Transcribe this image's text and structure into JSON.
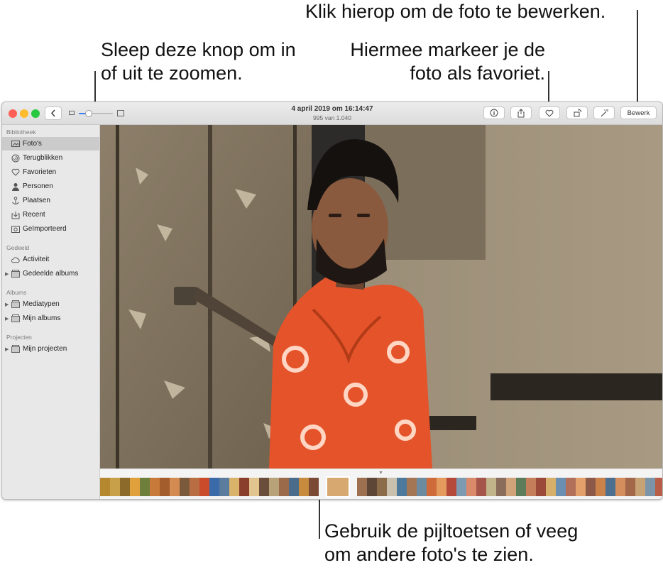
{
  "callouts": {
    "zoom": [
      "Sleep deze knop om in",
      "of uit te zoomen."
    ],
    "favorite": [
      "Hiermee markeer je de",
      "foto als favoriet."
    ],
    "edit": "Klik hierop om de foto te bewerken.",
    "arrows": [
      "Gebruik de pijltoetsen of veeg",
      "om andere foto's te zien."
    ]
  },
  "window": {
    "title": "4 april 2019 om 16:14:47",
    "subtitle": "995 van 1.040"
  },
  "toolbar": {
    "back_icon": "chevron-left-icon",
    "zoom_level": 0.3,
    "info_icon": "info-icon",
    "share_icon": "share-icon",
    "favorite_icon": "heart-icon",
    "rotate_icon": "rotate-icon",
    "enhance_icon": "magic-wand-icon",
    "edit_label": "Bewerk"
  },
  "sidebar": {
    "sections": [
      {
        "title": "Bibliotheek",
        "items": [
          {
            "label": "Foto's",
            "icon": "photos-icon",
            "selected": true
          },
          {
            "label": "Terugblikken",
            "icon": "memories-icon"
          },
          {
            "label": "Favorieten",
            "icon": "heart-icon"
          },
          {
            "label": "Personen",
            "icon": "person-icon"
          },
          {
            "label": "Plaatsen",
            "icon": "pin-icon"
          },
          {
            "label": "Recent",
            "icon": "import-icon"
          },
          {
            "label": "Geïmporteerd",
            "icon": "camera-icon"
          }
        ]
      },
      {
        "title": "Gedeeld",
        "items": [
          {
            "label": "Activiteit",
            "icon": "cloud-icon"
          },
          {
            "label": "Gedeelde albums",
            "icon": "folder-icon",
            "expandable": true
          }
        ]
      },
      {
        "title": "Albums",
        "items": [
          {
            "label": "Mediatypen",
            "icon": "folder-icon",
            "expandable": true
          },
          {
            "label": "Mijn albums",
            "icon": "folder-icon",
            "expandable": true
          }
        ]
      },
      {
        "title": "Projecten",
        "items": [
          {
            "label": "Mijn projecten",
            "icon": "folder-icon",
            "expandable": true
          }
        ]
      }
    ]
  },
  "colors": {
    "close": "#fe5f57",
    "minimize": "#febc2e",
    "zoom": "#28c840",
    "accent": "#3b82f6"
  },
  "filmstrip": {
    "thumbnail_colors": [
      "#b5872f",
      "#c9a04a",
      "#8c6b2a",
      "#e0a13c",
      "#6d7f3a",
      "#c77a3a",
      "#a35c2b",
      "#d48b52",
      "#7a5a3a",
      "#b86e42",
      "#c94b2a",
      "#3b6aa8",
      "#5b7c9c",
      "#d9b36a",
      "#8a3e2c",
      "#e2c48e",
      "#6a4d3a",
      "#b7a27a",
      "#9a6a4a",
      "#4a6b8a",
      "#c78b3e",
      "#7b4a35",
      "#d7a86f",
      "#9c7050",
      "#5e4636",
      "#8b6b4a",
      "#c9c0ae",
      "#4d7a9c",
      "#a57654",
      "#6c8aa0",
      "#cf6a3a",
      "#e59a5d",
      "#b64a3a",
      "#7d9ab0",
      "#d98a6a",
      "#a6554a",
      "#c2b48a",
      "#8a6d5a",
      "#d0a37a",
      "#5c7c5a",
      "#c47e5a",
      "#9b4a3a",
      "#d6b06a",
      "#6a8fb0",
      "#b0705a",
      "#e3a06a",
      "#8d5a4a",
      "#c9824a",
      "#4f6f8f",
      "#d48e5e",
      "#a3684a",
      "#c7a275",
      "#7c94a8",
      "#b85e48",
      "#9f8a6a",
      "#d27a4a",
      "#6b86a0",
      "#c6906a"
    ],
    "current_index": 22
  }
}
